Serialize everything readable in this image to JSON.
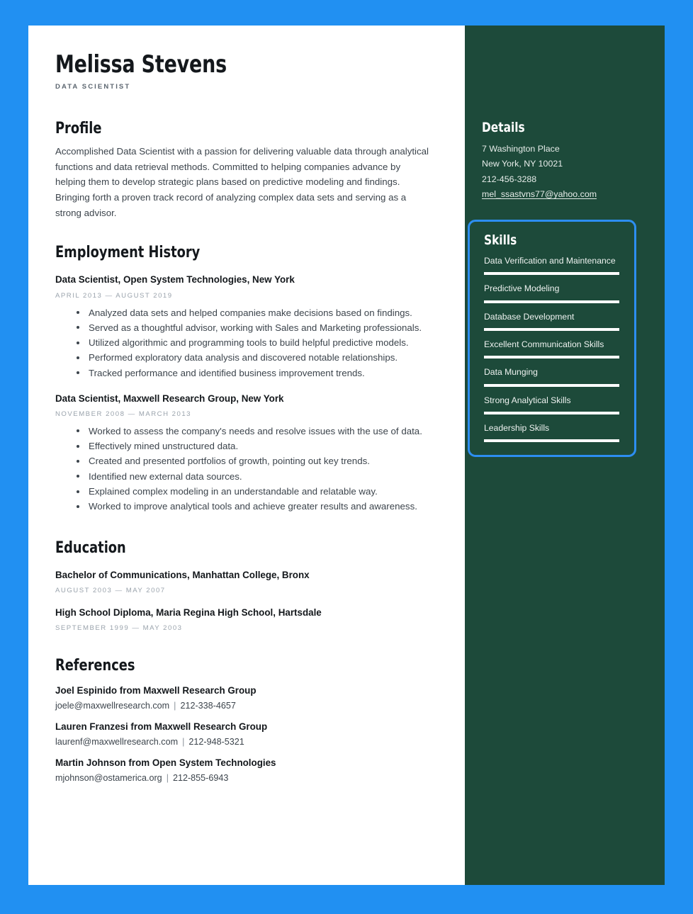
{
  "theme": {
    "canvas_blue": "#2190f2",
    "sidebar_green": "#1d4a3a",
    "selection_blue": "#2d8ef0",
    "paper_white": "#ffffff"
  },
  "header": {
    "name": "Melissa Stevens",
    "job_title": "DATA SCIENTIST"
  },
  "profile": {
    "heading": "Profile",
    "body": "Accomplished Data Scientist with a passion for delivering valuable data through analytical functions and data retrieval methods. Committed to helping companies advance by helping them to develop strategic plans based on predictive modeling and findings. Bringing forth a proven track record of analyzing complex data sets and serving as a strong advisor."
  },
  "employment": {
    "heading": "Employment History",
    "entries": [
      {
        "title": "Data Scientist, Open System Technologies, New York",
        "dates": "APRIL 2013 — AUGUST 2019",
        "bullets": [
          "Analyzed data sets and helped companies make decisions based on findings.",
          "Served as a thoughtful advisor, working with Sales and Marketing professionals.",
          "Utilized algorithmic and programming tools to build helpful predictive models.",
          "Performed exploratory data analysis and discovered notable relationships.",
          "Tracked performance and identified business improvement trends."
        ]
      },
      {
        "title": "Data Scientist, Maxwell Research Group, New York",
        "dates": "NOVEMBER 2008 — MARCH 2013",
        "bullets": [
          "Worked to assess the company's needs and resolve issues with the use of data.",
          "Effectively mined unstructured data.",
          "Created and presented portfolios of growth, pointing out key trends.",
          "Identified new external data sources.",
          "Explained complex modeling in an understandable and relatable way.",
          "Worked to improve analytical tools and achieve greater results and awareness."
        ]
      }
    ]
  },
  "education": {
    "heading": "Education",
    "entries": [
      {
        "title": "Bachelor of Communications, Manhattan College, Bronx",
        "dates": "AUGUST 2003 — MAY 2007"
      },
      {
        "title": "High School Diploma, Maria Regina High School, Hartsdale",
        "dates": "SEPTEMBER 1999 — MAY 2003"
      }
    ]
  },
  "references": {
    "heading": "References",
    "entries": [
      {
        "name": "Joel Espinido from Maxwell Research Group",
        "email": "joele@maxwellresearch.com",
        "separator": "|",
        "phone": "212-338-4657"
      },
      {
        "name": "Lauren Franzesi from Maxwell Research Group",
        "email": "laurenf@maxwellresearch.com",
        "separator": "|",
        "phone": "212-948-5321"
      },
      {
        "name": "Martin Johnson from Open System Technologies",
        "email": "mjohnson@ostamerica.org",
        "separator": "|",
        "phone": "212-855-6943"
      }
    ]
  },
  "details": {
    "heading": "Details",
    "address_line1": "7 Washington Place",
    "address_line2": "New York, NY 10021",
    "phone": "212-456-3288",
    "email": "mel_ssastvns77@yahoo.com"
  },
  "skills": {
    "heading": "Skills",
    "items": [
      {
        "label": "Data Verification and Maintenance"
      },
      {
        "label": "Predictive Modeling"
      },
      {
        "label": "Database Development"
      },
      {
        "label": "Excellent Communication Skills"
      },
      {
        "label": "Data Munging"
      },
      {
        "label": "Strong Analytical Skills"
      },
      {
        "label": "Leadership Skills"
      }
    ]
  }
}
